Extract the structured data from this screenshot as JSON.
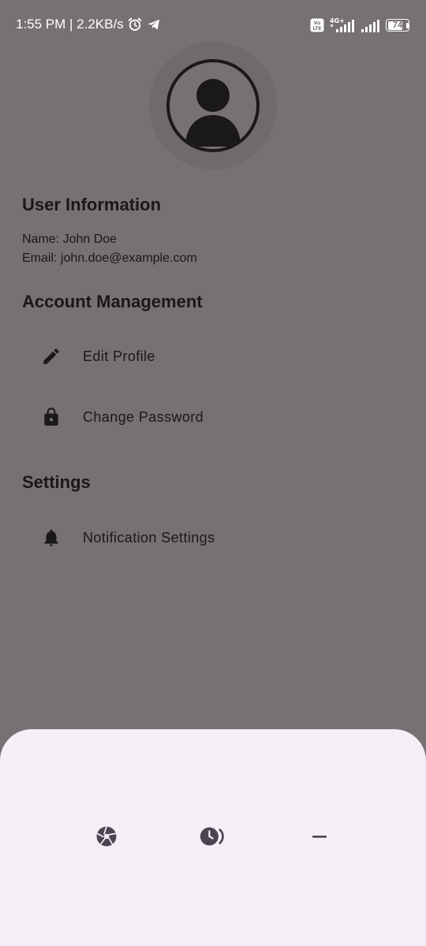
{
  "status_bar": {
    "time_speed": "1:55 PM | 2.2KB/s",
    "alarm_icon": "alarm-icon",
    "telegram_icon": "telegram-icon",
    "volte_label": "Vo LTE",
    "network_label": "4G+",
    "battery_level": "74",
    "battery_fraction": 0.74
  },
  "profile": {
    "avatar_icon": "account-circle-icon"
  },
  "user_information": {
    "heading": "User Information",
    "name_line": "Name: John Doe",
    "email_line": "Email: john.doe@example.com"
  },
  "account_management": {
    "heading": "Account Management",
    "items": [
      {
        "label": "Edit Profile",
        "icon": "pencil-icon"
      },
      {
        "label": "Change Password",
        "icon": "lock-icon"
      }
    ]
  },
  "settings": {
    "heading": "Settings",
    "items": [
      {
        "label": "Notification Settings",
        "icon": "bell-icon"
      }
    ]
  },
  "bottom_sheet": {
    "buttons": [
      {
        "icon": "shutter-icon"
      },
      {
        "icon": "timer-icon"
      },
      {
        "icon": "minimize-icon"
      }
    ]
  },
  "colors": {
    "scrim_background": "#767173",
    "text_primary": "#1b181c",
    "sheet_background": "#f4eff7",
    "sheet_icon": "#4a4550"
  }
}
